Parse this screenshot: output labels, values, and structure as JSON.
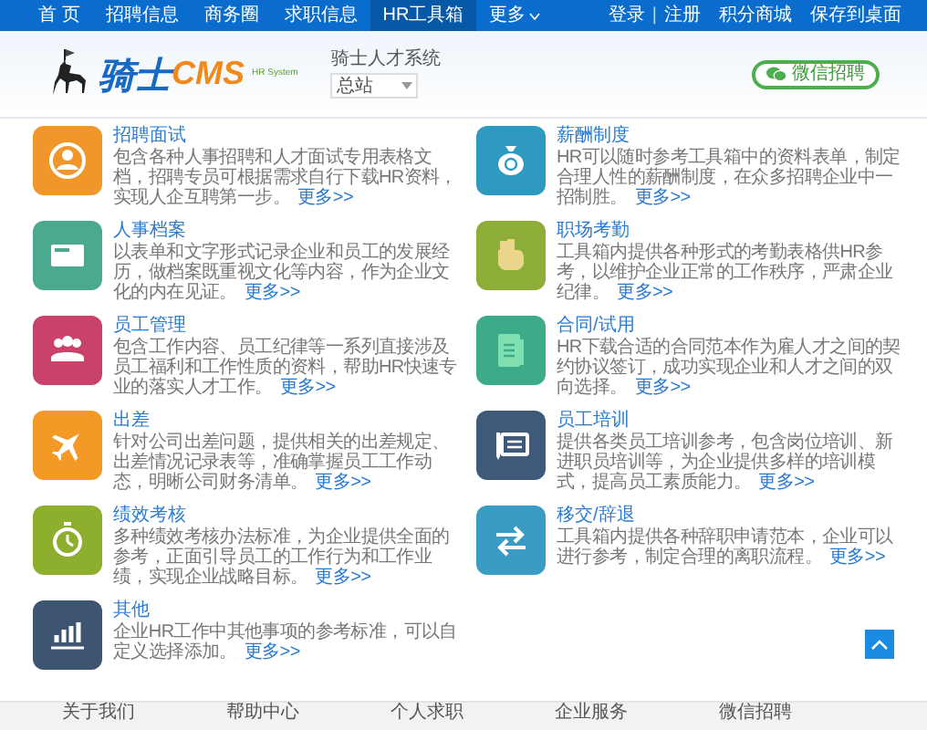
{
  "nav": {
    "items": [
      {
        "label": "首 页",
        "selected": false
      },
      {
        "label": "招聘信息",
        "selected": false
      },
      {
        "label": "商务圈",
        "selected": false
      },
      {
        "label": "求职信息",
        "selected": false
      },
      {
        "label": "HR工具箱",
        "selected": true
      },
      {
        "label": "更多",
        "selected": false
      }
    ],
    "login": "登录",
    "separator": "|",
    "register": "注册",
    "points_mall": "积分商城",
    "save_desktop": "保存到桌面"
  },
  "header": {
    "logo_main": "骑士",
    "logo_cms": "CMS",
    "logo_sub": "HR System",
    "site_name": "骑士人才系统",
    "site_select": "总站",
    "wechat_button": "微信招聘"
  },
  "tools": [
    {
      "title": "招聘面试",
      "description": "包含各种人事招聘和人才面试专用表格文档，招聘专员可根据需求自行下载HR资料，实现人企互聘第一步。",
      "more": "更多>>",
      "color": "#f0962a"
    },
    {
      "title": "薪酬制度",
      "description": "HR可以随时参考工具箱中的资料表单，制定合理人性的薪酬制度，在众多招聘企业中一招制胜。",
      "more": "更多>>",
      "color": "#2e9ac2"
    },
    {
      "title": "人事档案",
      "description": "以表单和文字形式记录企业和员工的发展经历，做档案既重视文化等内容，作为企业文化的内在见证。",
      "more": "更多>>",
      "color": "#4aa98e"
    },
    {
      "title": "职场考勤",
      "description": "工具箱内提供各种形式的考勤表格供HR参考，以维护企业正常的工作秩序，严肃企业纪律。",
      "more": "更多>>",
      "color": "#8eae3a"
    },
    {
      "title": "员工管理",
      "description": "包含工作内容、员工纪律等一系列直接涉及员工福利和工作性质的资料，帮助HR快速专业的落实人才工作。",
      "more": "更多>>",
      "color": "#c8426a"
    },
    {
      "title": "合同/试用",
      "description": "HR下载合适的合同范本作为雇人才之间的契约协议签订，成功实现企业和人才之间的双向选择。",
      "more": "更多>>",
      "color": "#3daa8a"
    },
    {
      "title": "出差",
      "description": "针对公司出差问题，提供相关的出差规定、出差情况记录表等，准确掌握员工工作动态，明晰公司财务清单。",
      "more": "更多>>",
      "color": "#f39a26"
    },
    {
      "title": "员工培训",
      "description": "提供各类员工培训参考，包含岗位培训、新进职员培训等，为企业提供多样的培训模式，提高员工素质能力。",
      "more": "更多>>",
      "color": "#3f5a78"
    },
    {
      "title": "绩效考核",
      "description": "多种绩效考核办法标准，为企业提供全面的参考，正面引导员工的工作行为和工作业绩，实现企业战略目标。",
      "more": "更多>>",
      "color": "#8eae2e"
    },
    {
      "title": "移交/辞退",
      "description": "工具箱内提供各种辞职申请范本，企业可以进行参考，制定合理的离职流程。",
      "more": "更多>>",
      "color": "#3a9cc4"
    },
    {
      "title": "其他",
      "description": "企业HR工作中其他事项的参考标准，可以自定义选择添加。",
      "more": "更多>>",
      "color": "#3d5570"
    }
  ],
  "footer": {
    "columns": [
      "关于我们",
      "帮助中心",
      "个人求职",
      "企业服务",
      "微信招聘"
    ]
  }
}
